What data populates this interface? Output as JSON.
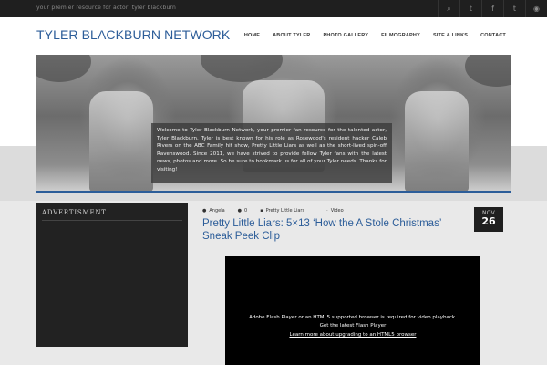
{
  "topbar": {
    "tagline": "your premier resource for actor, tyler blackburn",
    "icons": [
      {
        "name": "search-icon",
        "glyph": "⌕"
      },
      {
        "name": "twitter-icon",
        "glyph": "t"
      },
      {
        "name": "facebook-icon",
        "glyph": "f"
      },
      {
        "name": "tumblr-icon",
        "glyph": "t"
      },
      {
        "name": "rss-icon",
        "glyph": "◉"
      }
    ]
  },
  "header": {
    "logo": "TYLER BLACKBURN NETWORK",
    "nav": [
      "HOME",
      "ABOUT TYLER",
      "PHOTO GALLERY",
      "FILMOGRAPHY",
      "SITE & LINKS",
      "CONTACT"
    ]
  },
  "hero": {
    "caption": "Welcome to Tyler Blackburn Network, your premier fan resource for the talented actor, Tyler Blackburn. Tyler is best known for his role as Rosewood's resident hacker Caleb Rivers on the ABC Family hit show, Pretty Little Liars as well as the short-lived spin-off Ravenswood. Since 2011, we have strived to provide fellow Tyler fans with the latest news, photos and more. So be sure to bookmark us for all of your Tyler needs. Thanks for visiting!"
  },
  "sidebar": {
    "title": "ADVERTISMENT"
  },
  "post": {
    "author": "Angela",
    "comments": "0",
    "category": "Pretty Little Liars",
    "tag": "Video",
    "date_month": "NOV",
    "date_day": "26",
    "title": "Pretty Little Liars: 5×13 ‘How the A Stole Christmas’ Sneak Peek Clip",
    "video_message": "Adobe Flash Player or an HTML5 supported browser is required for video playback.",
    "video_link1": "Get the latest Flash Player",
    "video_link2": "Learn more about upgrading to an HTML5 browser"
  },
  "colors": {
    "accent": "#2c5d99",
    "topbar": "#1f1f1f",
    "sidebar": "#222222"
  }
}
